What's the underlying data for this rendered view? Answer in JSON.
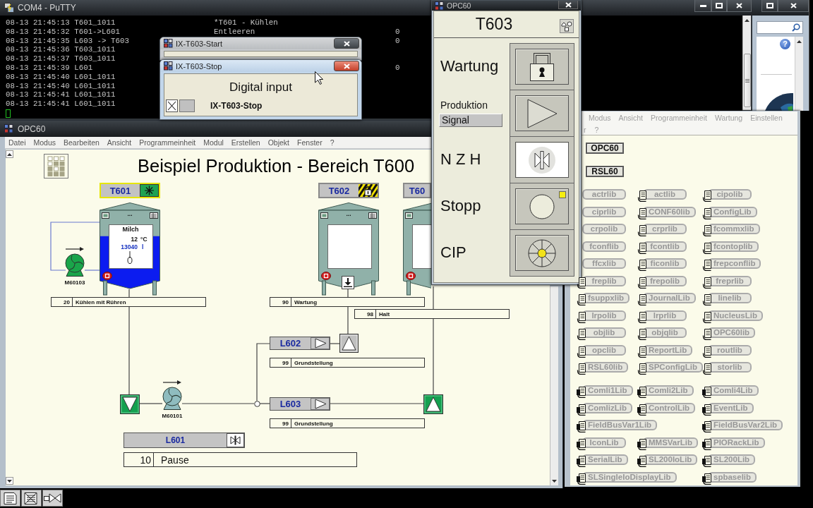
{
  "terminal": {
    "title": "COM4 - PuTTY",
    "lines": [
      {
        "text": "08-13 21:45:13 T601_1011",
        "message": "*T601 - Kühlen"
      },
      {
        "text": "08-13 21:45:32 T601->L601",
        "message": "Entleeren",
        "count": "0"
      },
      {
        "text": "08-13 21:45:35 L603 -> T603",
        "count": "0"
      },
      {
        "text": "08-13 21:45:36 T603_1011"
      },
      {
        "text": "08-13 21:45:37 T603_1011"
      },
      {
        "text": "08-13 21:45:39 L601",
        "count": "0"
      },
      {
        "text": "08-13 21:45:40 L601_1011"
      },
      {
        "text": "08-13 21:45:40 L601_1011"
      },
      {
        "text": "08-13 21:45:41 L601_1011"
      },
      {
        "text": "08-13 21:45:41 L601_1011"
      }
    ]
  },
  "explorer": {
    "help": "?"
  },
  "dialogs": [
    {
      "title": "IX-T603-Start",
      "active": false
    },
    {
      "title": "IX-T603-Stop",
      "active": true,
      "heading": "Digital input",
      "checked": true,
      "lamp_on": false,
      "label": "IX-T603-Stop"
    }
  ],
  "main_window": {
    "title": "OPC60",
    "menu": [
      "Datei",
      "Modus",
      "Bearbeiten",
      "Ansicht",
      "Programmeinheit",
      "Modul",
      "Erstellen",
      "Objekt",
      "Fenster",
      "?"
    ],
    "diagram": {
      "title": "Beispiel Produktion - Bereich T600",
      "tanks": [
        {
          "name": "T601",
          "selected": true,
          "kind": "cooling",
          "label": "...",
          "product": "Milch",
          "temperature": "12",
          "temperature_unit": "°C",
          "volume": "13040",
          "volume_unit": "l",
          "agitator": true,
          "level": 0.67,
          "alarm": true,
          "outlet": false,
          "status": {
            "code": "20",
            "text": "Kühlen mit Rühren"
          }
        },
        {
          "name": "T602",
          "selected": false,
          "kind": "maintenance",
          "label": "...",
          "agitator": false,
          "alarm": true,
          "outlet": true,
          "status": {
            "code": "90",
            "text": "Wartung"
          }
        },
        {
          "name": "T60",
          "selected": false,
          "kind": "plain",
          "agitator": false,
          "alarm": true,
          "outlet": false,
          "status": {
            "code": "98",
            "text": "Halt"
          }
        }
      ],
      "pumps": [
        {
          "name": "M60103",
          "running": true
        },
        {
          "name": "M60101",
          "running": false
        }
      ],
      "valves": [
        {
          "kind": "down",
          "open": true
        },
        {
          "kind": "up",
          "open": false
        },
        {
          "kind": "up",
          "open": true
        }
      ],
      "transfer_lines": [
        {
          "name": "L602",
          "kind": "play",
          "status": {
            "code": "99",
            "text": "Grundstellung"
          }
        },
        {
          "name": "L603",
          "kind": "play",
          "status": {
            "code": "99",
            "text": "Grundstellung"
          }
        },
        {
          "name": "L601",
          "kind": "valve",
          "status": {
            "code": "10",
            "text": "Pause"
          }
        }
      ]
    }
  },
  "unit_panel": {
    "title": "OPC60",
    "unit": "T603",
    "rows": [
      {
        "label": "Wartung",
        "kind": "padlock",
        "active": false,
        "flag": false
      },
      {
        "label": "Produktion",
        "field": "Signal",
        "kind": "play",
        "active": false,
        "flag": false
      },
      {
        "label": "N Z H",
        "kind": "valve",
        "active": true,
        "flag": false
      },
      {
        "label": "Stopp",
        "kind": "stop",
        "active": false,
        "flag": true
      },
      {
        "label": "CIP",
        "kind": "cip",
        "active": false,
        "flag": false
      }
    ]
  },
  "library_window": {
    "menu": [
      "Modus",
      "Ansicht",
      "Programmeinheit",
      "Wartung",
      "Einstellen"
    ],
    "menu_more": [
      "r",
      "?"
    ],
    "systems": [
      "OPC60",
      "RSL60"
    ],
    "groups": [
      {
        "kind": "library",
        "rows": [
          [
            {
              "label": "actrlib",
              "icon": false
            },
            {
              "label": "actlib",
              "icon": true
            },
            {
              "label": "cipolib",
              "icon": true
            }
          ],
          [
            {
              "label": "ciprlib",
              "icon": false
            },
            {
              "label": "CONF60lib",
              "icon": true
            },
            {
              "label": "ConfigLib",
              "icon": true
            }
          ],
          [
            {
              "label": "crpolib",
              "icon": false
            },
            {
              "label": "crprlib",
              "icon": true
            },
            {
              "label": "fcommxlib",
              "icon": true
            }
          ],
          [
            {
              "label": "fconflib",
              "icon": false
            },
            {
              "label": "fcontlib",
              "icon": true
            },
            {
              "label": "fcontoplib",
              "icon": true
            }
          ],
          [
            {
              "label": "ffcxlib",
              "icon": false
            },
            {
              "label": "ficonlib",
              "icon": true
            },
            {
              "label": "frepconflib",
              "icon": true
            }
          ],
          [
            {
              "label": "freplib",
              "icon": true
            },
            {
              "label": "frepolib",
              "icon": true
            },
            {
              "label": "freprlib",
              "icon": true
            }
          ],
          [
            {
              "label": "fsuppxlib",
              "icon": true
            },
            {
              "label": "JournalLib",
              "icon": true
            },
            {
              "label": "linelib",
              "icon": true
            }
          ],
          [
            {
              "label": "lrpolib",
              "icon": true
            },
            {
              "label": "lrprlib",
              "icon": true
            },
            {
              "label": "NucleusLib",
              "icon": true
            }
          ],
          [
            {
              "label": "objlib",
              "icon": true
            },
            {
              "label": "objqlib",
              "icon": true
            },
            {
              "label": "OPC60lib",
              "icon": true
            }
          ],
          [
            {
              "label": "opclib",
              "icon": true
            },
            {
              "label": "ReportLib",
              "icon": true
            },
            {
              "label": "routlib",
              "icon": true
            }
          ],
          [
            {
              "label": "RSL60lib",
              "icon": true
            },
            {
              "label": "SPConfigLib",
              "icon": true
            },
            {
              "label": "storlib",
              "icon": true
            }
          ]
        ]
      },
      {
        "kind": "comm",
        "rows": [
          [
            {
              "label": "Comli1Lib",
              "icon": true
            },
            {
              "label": "Comli2Lib",
              "icon": true
            },
            {
              "label": "Comli4Lib",
              "icon": true
            }
          ],
          [
            {
              "label": "ComlizLib",
              "icon": true
            },
            {
              "label": "ControlLib",
              "icon": true
            },
            {
              "label": "EventLib",
              "icon": true
            }
          ],
          [
            {
              "label": "FieldBusVar1Lib",
              "icon": true
            },
            {
              "label": "FieldBusVar2Lib",
              "icon": true
            }
          ],
          [
            {
              "label": "IconLib",
              "icon": true
            },
            {
              "label": "MMSVarLib",
              "icon": true
            },
            {
              "label": "PIORackLib",
              "icon": true
            }
          ],
          [
            {
              "label": "SerialLib",
              "icon": true
            },
            {
              "label": "SL200IoLib",
              "icon": true
            },
            {
              "label": "SL200Lib",
              "icon": true
            }
          ],
          [
            {
              "label": "SLSingleIoDisplayLib",
              "icon": true
            },
            {
              "label": "spbaselib",
              "icon": true
            }
          ]
        ]
      }
    ]
  }
}
